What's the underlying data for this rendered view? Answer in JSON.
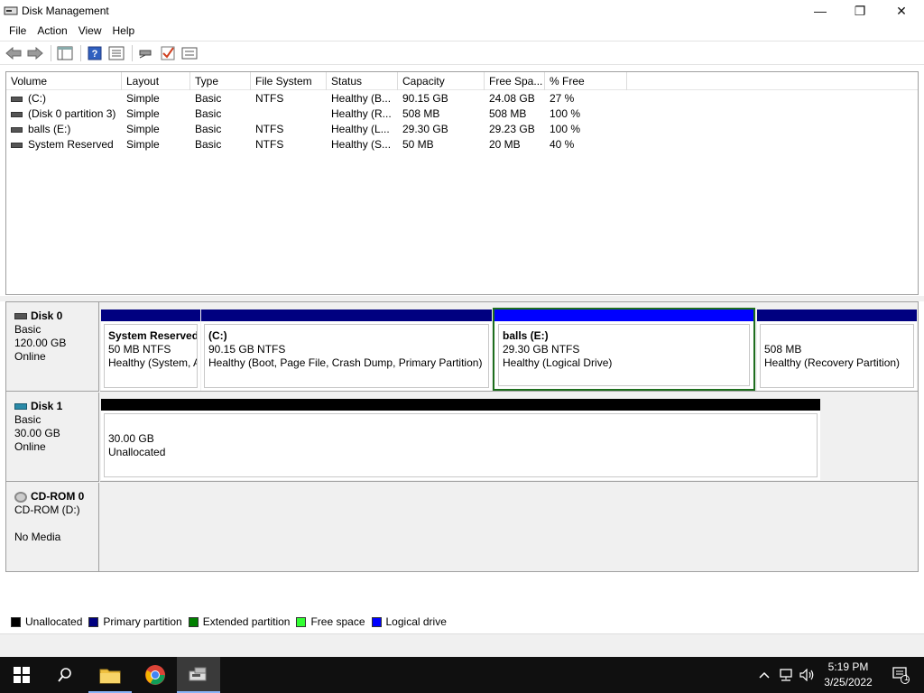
{
  "window": {
    "title": "Disk Management",
    "minimize_glyph": "—",
    "maximize_glyph": "❐",
    "close_glyph": "✕"
  },
  "menu": [
    "File",
    "Action",
    "View",
    "Help"
  ],
  "toolbar": {
    "icons": [
      "back-arrow-icon",
      "forward-arrow-icon",
      "show-hide-console-tree-icon",
      "help-icon",
      "properties-icon",
      "connect-icon",
      "check-icon",
      "list-view-icon"
    ]
  },
  "volume_table": {
    "columns": [
      "Volume",
      "Layout",
      "Type",
      "File System",
      "Status",
      "Capacity",
      "Free Spa...",
      "% Free"
    ],
    "rows": [
      {
        "volume": "(C:)",
        "layout": "Simple",
        "type": "Basic",
        "fs": "NTFS",
        "status": "Healthy (B...",
        "capacity": "90.15 GB",
        "free": "24.08 GB",
        "pct": "27 %"
      },
      {
        "volume": "(Disk 0 partition 3)",
        "layout": "Simple",
        "type": "Basic",
        "fs": "",
        "status": "Healthy (R...",
        "capacity": "508 MB",
        "free": "508 MB",
        "pct": "100 %"
      },
      {
        "volume": "balls (E:)",
        "layout": "Simple",
        "type": "Basic",
        "fs": "NTFS",
        "status": "Healthy (L...",
        "capacity": "29.30 GB",
        "free": "29.23 GB",
        "pct": "100 %"
      },
      {
        "volume": "System Reserved",
        "layout": "Simple",
        "type": "Basic",
        "fs": "NTFS",
        "status": "Healthy (S...",
        "capacity": "50 MB",
        "free": "20 MB",
        "pct": "40 %"
      }
    ]
  },
  "disks": {
    "disk0": {
      "name": "Disk 0",
      "type": "Basic",
      "size": "120.00 GB",
      "state": "Online",
      "partitions": [
        {
          "name": "System Reserved",
          "size": "50 MB NTFS",
          "status": "Healthy (System, A"
        },
        {
          "name": "(C:)",
          "size": "90.15 GB NTFS",
          "status": "Healthy (Boot, Page File, Crash Dump, Primary Partition)"
        },
        {
          "name": "balls  (E:)",
          "size": "29.30 GB NTFS",
          "status": "Healthy (Logical Drive)"
        },
        {
          "name": "",
          "size": "508 MB",
          "status": "Healthy (Recovery Partition)"
        }
      ]
    },
    "disk1": {
      "name": "Disk 1",
      "type": "Basic",
      "size": "30.00 GB",
      "state": "Online",
      "partitions": [
        {
          "size": "30.00 GB",
          "status": "Unallocated"
        }
      ]
    },
    "cdrom0": {
      "name": "CD-ROM 0",
      "drive": "CD-ROM (D:)",
      "media": "No Media"
    }
  },
  "legend": [
    {
      "label": "Unallocated",
      "color": "#000000"
    },
    {
      "label": "Primary partition",
      "color": "#000080"
    },
    {
      "label": "Extended partition",
      "color": "#008000"
    },
    {
      "label": "Free space",
      "color": "#33ff33"
    },
    {
      "label": "Logical drive",
      "color": "#0000ff"
    }
  ],
  "taskbar": {
    "time": "5:19 PM",
    "date": "3/25/2022",
    "notification_count": "1"
  }
}
